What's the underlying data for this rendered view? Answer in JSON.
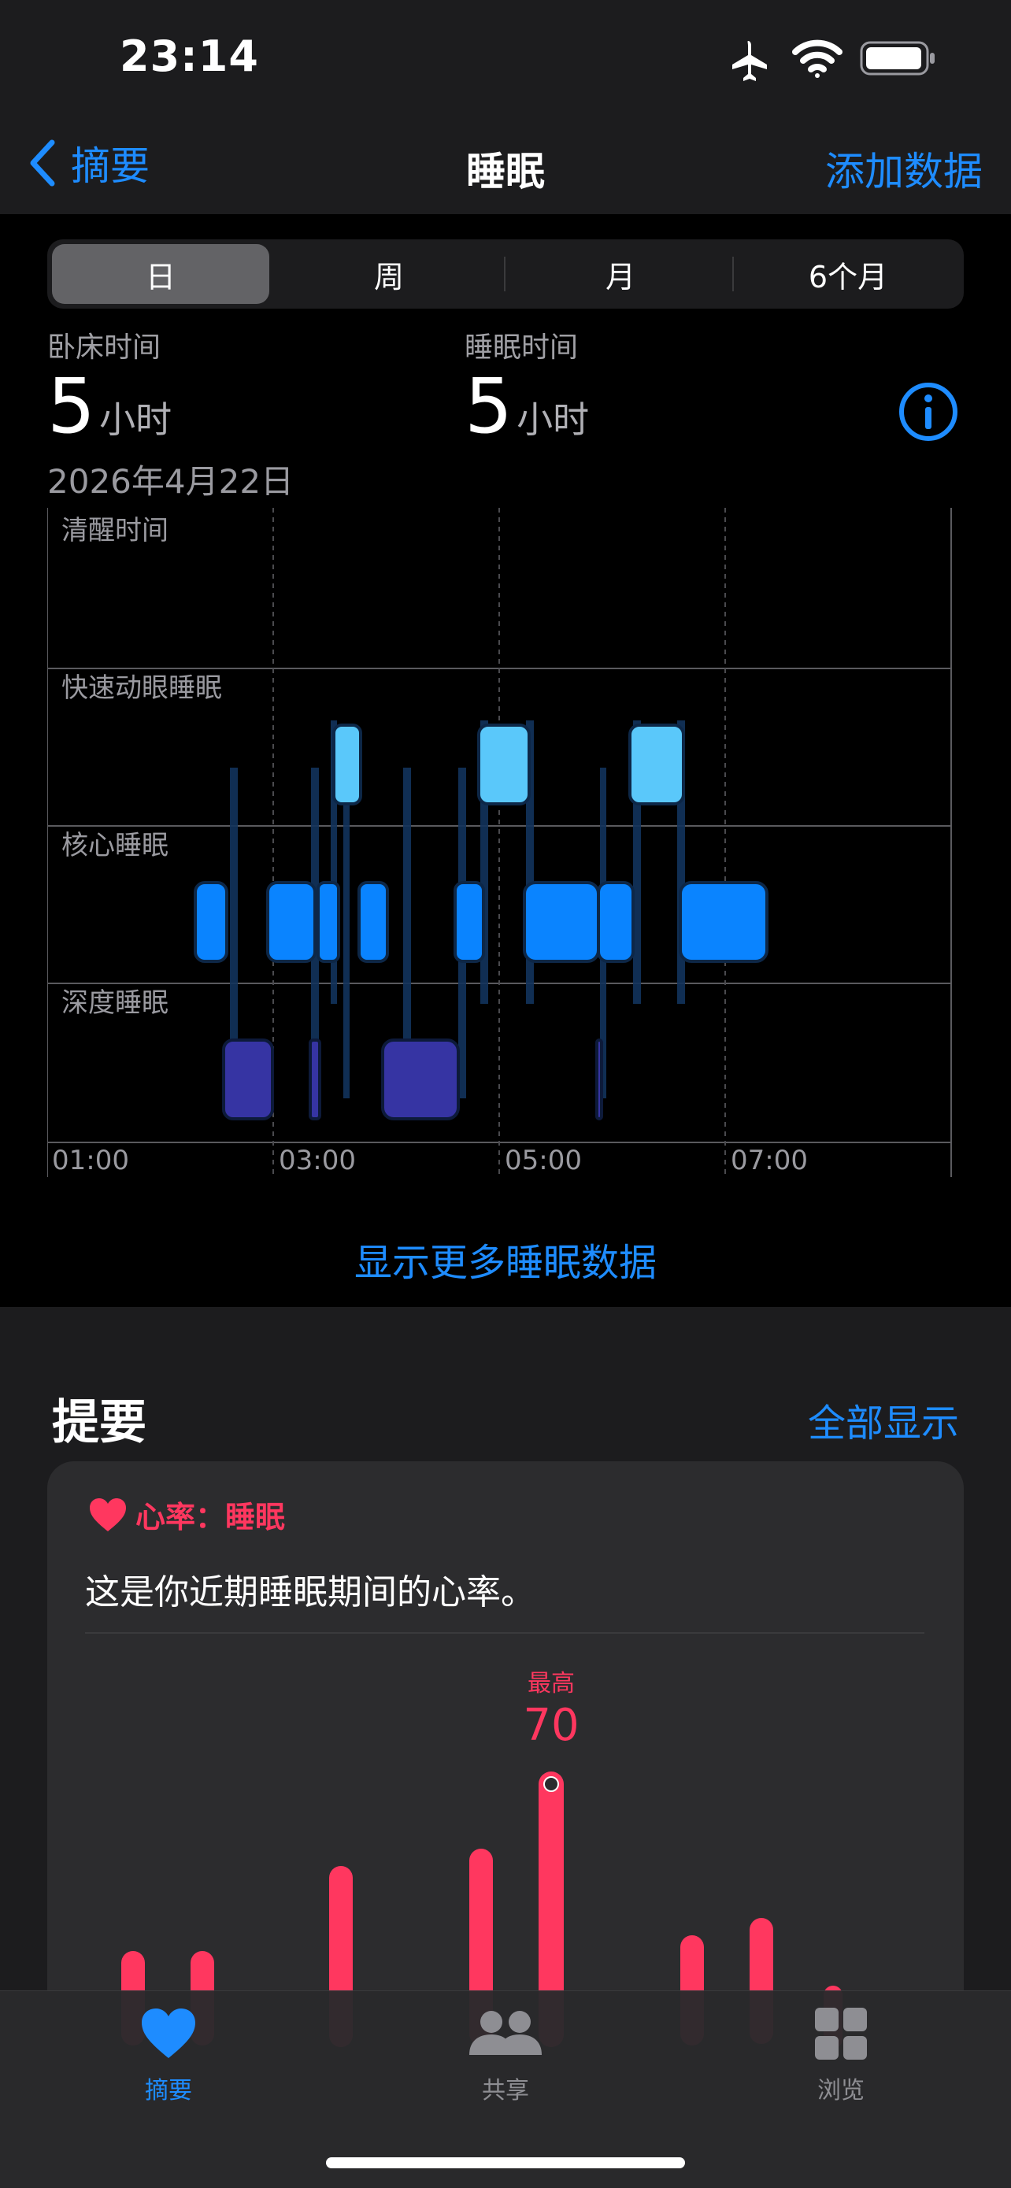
{
  "status": {
    "time": "23:14"
  },
  "nav": {
    "back_label": "摘要",
    "title": "睡眠",
    "action_label": "添加数据"
  },
  "segments": [
    {
      "label": "日",
      "selected": true
    },
    {
      "label": "周"
    },
    {
      "label": "月"
    },
    {
      "label": "6个月"
    }
  ],
  "stats": {
    "in_bed": {
      "label": "卧床时间",
      "value": "5",
      "unit": "小时"
    },
    "asleep": {
      "label": "睡眠时间",
      "value": "5",
      "unit": "小时"
    },
    "date": "2026年4月22日"
  },
  "sleep_chart": {
    "stages": [
      "清醒时间",
      "快速动眼睡眠",
      "核心睡眠",
      "深度睡眠"
    ],
    "x_ticks": [
      "01:00",
      "03:00",
      "05:00",
      "07:00"
    ],
    "colors": {
      "awake": "#ff7b62",
      "rem": "#5ac8fa",
      "core": "#0a84ff",
      "deep": "#3634a3"
    }
  },
  "more_link": "显示更多睡眠数据",
  "highlights": {
    "title": "提要",
    "show_all": "全部显示",
    "card": {
      "category": "心率：睡眠",
      "text": "这是你近期睡眠期间的心率。",
      "max_label": "最高",
      "max_value": "70",
      "accent": "#ff375f"
    }
  },
  "tabs": [
    {
      "label": "摘要",
      "icon": "heart-icon",
      "active": true
    },
    {
      "label": "共享",
      "icon": "people-icon"
    },
    {
      "label": "浏览",
      "icon": "grid-icon"
    }
  ]
}
